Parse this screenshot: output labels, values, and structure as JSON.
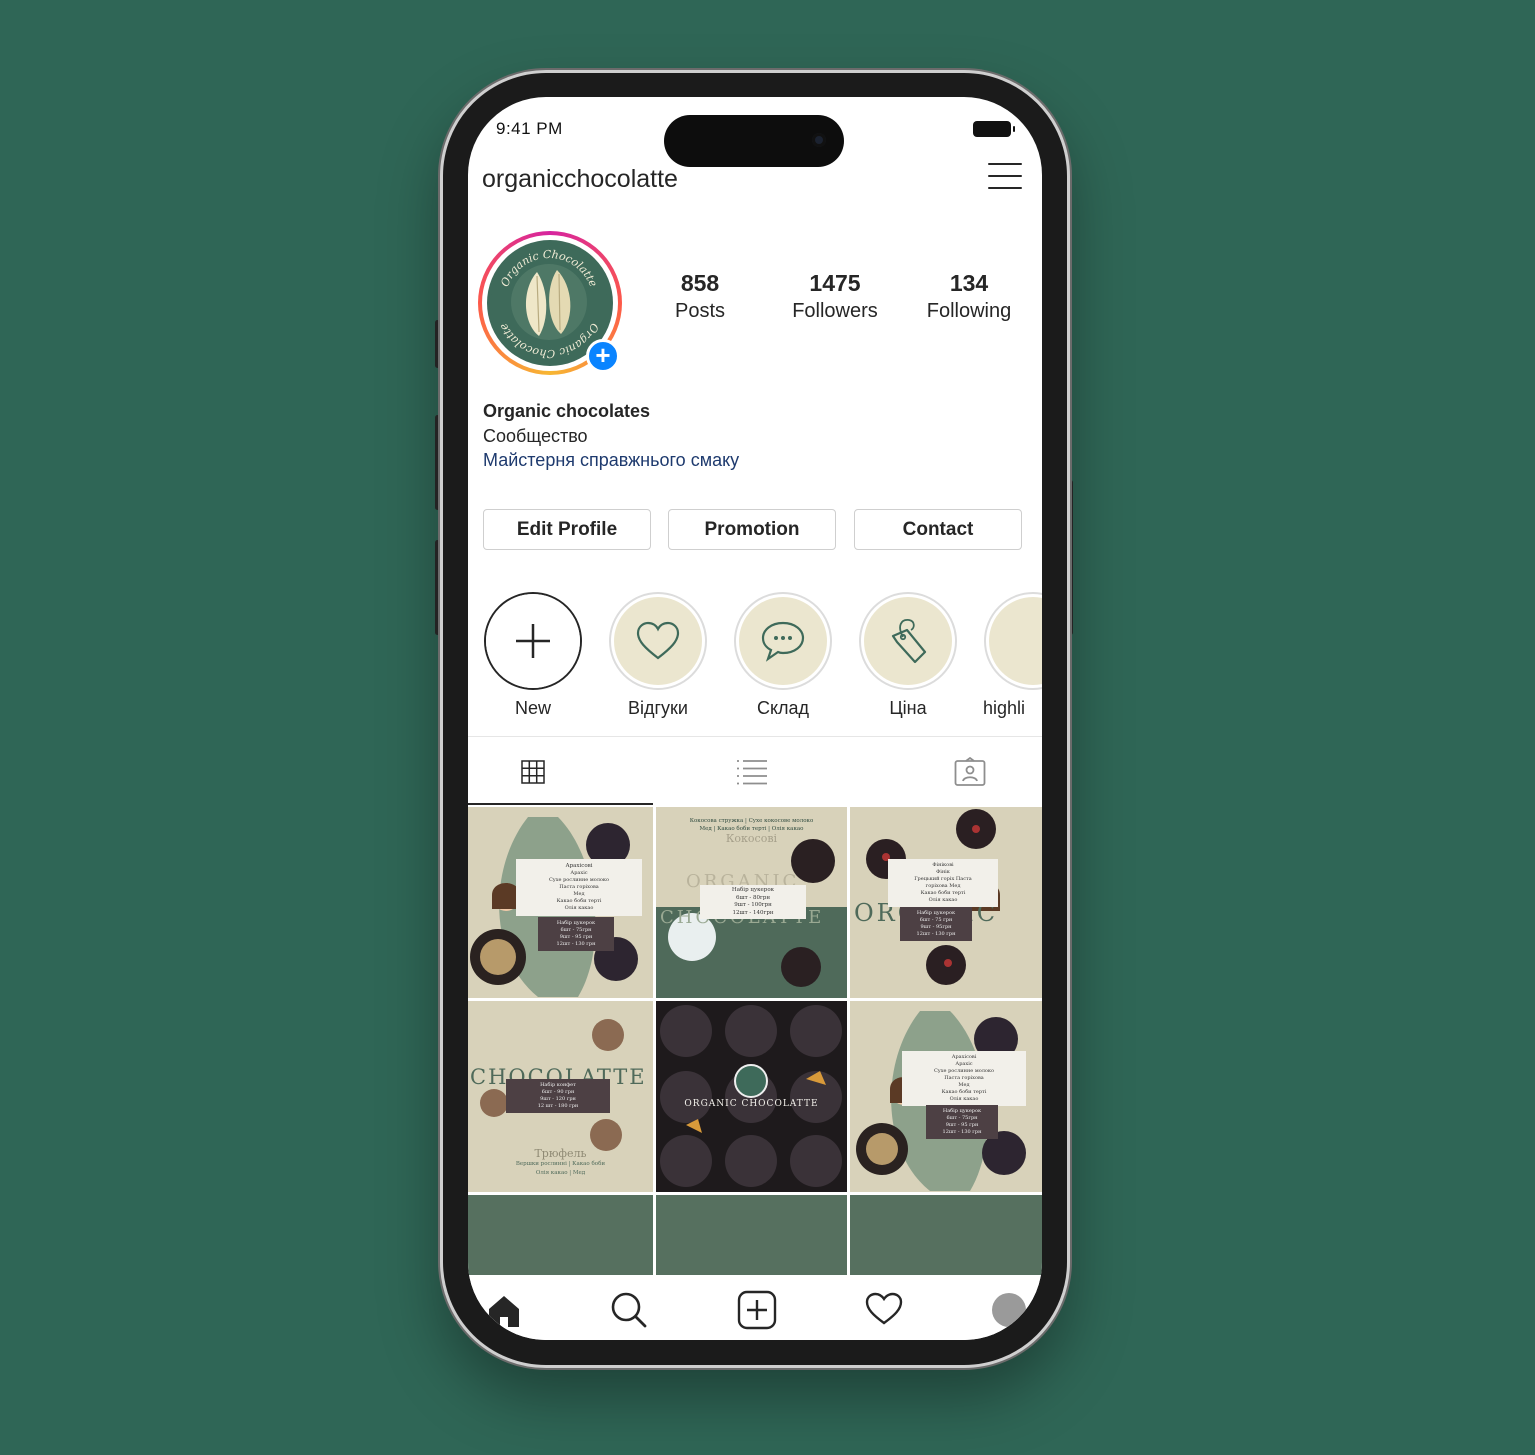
{
  "status_bar": {
    "time": "9:41 PM"
  },
  "header": {
    "username": "organicchocolatte"
  },
  "profile": {
    "stats": [
      {
        "value": "858",
        "label": "Posts"
      },
      {
        "value": "1475",
        "label": "Followers"
      },
      {
        "value": "134",
        "label": "Following"
      }
    ],
    "avatar_logo_text": [
      "Organic Chocolatte",
      "Organic Chocolatte"
    ],
    "bio": {
      "name": "Organic chocolates",
      "category": "Сообщество",
      "tagline": "Майстерня справжнього смаку"
    }
  },
  "actions": {
    "edit_profile": "Edit Profile",
    "promotion": "Promotion",
    "contact": "Contact"
  },
  "highlights": [
    {
      "label": "New",
      "icon": "plus-icon"
    },
    {
      "label": "Відгуки",
      "icon": "heart-icon"
    },
    {
      "label": "Склад",
      "icon": "chat-bubble-icon"
    },
    {
      "label": "Ціна",
      "icon": "price-tag-icon"
    },
    {
      "label": "highli",
      "icon": ""
    }
  ],
  "tabs": [
    {
      "icon": "grid-icon",
      "active": true
    },
    {
      "icon": "list-icon",
      "active": false
    },
    {
      "icon": "tagged-icon",
      "active": false
    }
  ],
  "posts": [
    {
      "heading": "Арахісові",
      "lines": [
        "Арахіс",
        "Сухе рослинне молоко",
        "Паста горіхова",
        "Мед",
        "Какао боби терті",
        "Олія какао"
      ],
      "price_title": "Набір цукерок",
      "prices": [
        "6шт - 75грн",
        "9шт - 95 грн",
        "12шт - 130 грн"
      ]
    },
    {
      "top_line1": "Кокосова стружка | Сухе кокосове молоко",
      "top_line2": "Мед | Какао боби терті | Олія какао",
      "heading": "Кокосові",
      "brand": "ORGANIC",
      "brand2": "CHOCOLATTE",
      "price_title": "Набір цукерок",
      "prices": [
        "6шт - 80грн",
        "9шт - 100грн",
        "12шт - 140грн"
      ]
    },
    {
      "heading": "Фінікові",
      "lines": [
        "Фінік",
        "Грецький горіх Паста",
        "горіхова Мед",
        "Какао боби терті",
        "Олія какао"
      ],
      "price_title": "Набір цукерок",
      "prices": [
        "6шт - 75 грн",
        "9шт - 95грн",
        "12шт - 130 грн"
      ],
      "brand": "ORGANIC"
    },
    {
      "brand": "CHOCOLATTE",
      "price_title": "Набір конфет",
      "prices": [
        "6шт - 90 грн",
        "9шт - 120 грн",
        "12 шт - 180 грн"
      ],
      "heading": "Трюфель",
      "bottom1": "Вершки рослинні | Какао боби",
      "bottom2": "Олія какао | Мед"
    },
    {
      "brand": "ORGANIC CHOCOLATTE"
    },
    {
      "heading": "Арахісові",
      "lines": [
        "Арахіс",
        "Сухе рослинне молоко",
        "Паста горіхова",
        "Мед",
        "Какао боби терті",
        "Олія какао"
      ],
      "price_title": "Набір цукерок",
      "prices": [
        "6шт - 75грн",
        "9шт - 95 грн",
        "12шт - 130 грн"
      ]
    }
  ],
  "bottom_nav": [
    "home-icon",
    "search-icon",
    "new-post-icon",
    "activity-heart-icon",
    "profile-avatar-icon"
  ],
  "colors": {
    "background": "#2f6656",
    "post_beige": "#d8d2ba",
    "brand_green": "#3e6a5a",
    "highlight_fill": "#ebe6cf",
    "link": "#1e3a6e"
  }
}
